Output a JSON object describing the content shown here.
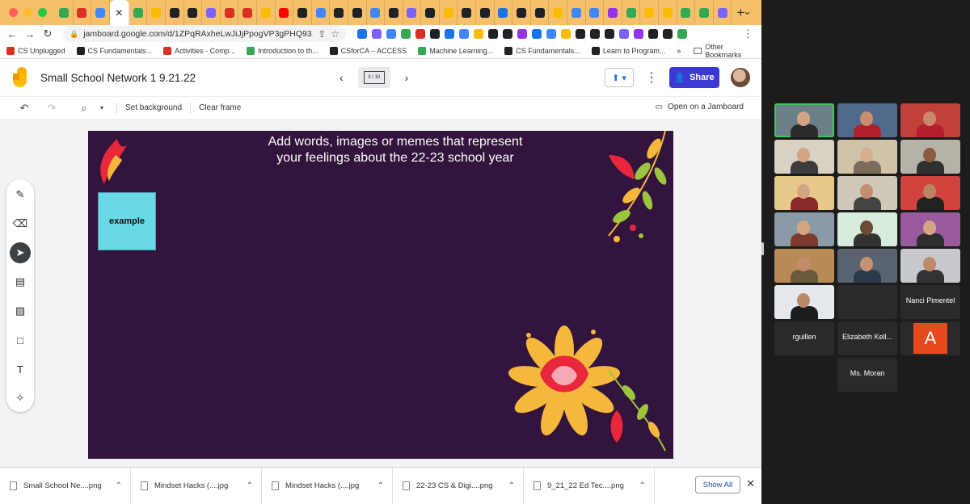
{
  "browser": {
    "active_tab_close": "✕",
    "new_tab": "+",
    "url": "jamboard.google.com/d/1ZPqRAxheLwJiJjPpogVP3gPHQ93...",
    "tab_favicon_colors": [
      "#34a853",
      "#d93025",
      "#4285f4",
      "#34a853",
      "#fbbc04",
      "#202124",
      "#202124",
      "#7b61ff",
      "#d93025",
      "#d93025",
      "#fbbc04",
      "#ff0000",
      "#202124",
      "#4285f4",
      "#202124",
      "#202124",
      "#4285f4",
      "#202124",
      "#7b61ff",
      "#202124",
      "#fbbc04",
      "#202124",
      "#202124",
      "#1a73e8",
      "#202124",
      "#202124",
      "#fbbc04",
      "#4285f4",
      "#4285f4",
      "#9334e6",
      "#34a853",
      "#fbbc04",
      "#fbbc04",
      "#34a853",
      "#34a853",
      "#7b61ff"
    ],
    "ext_icon_colors": [
      "#1a73e8",
      "#7b61ff",
      "#4285f4",
      "#34a853",
      "#d93025",
      "#202124",
      "#1a73e8",
      "#4285f4",
      "#fbbc04",
      "#202124",
      "#202124",
      "#9334e6",
      "#1a73e8",
      "#4285f4",
      "#fbbc04",
      "#202124",
      "#202124",
      "#202124",
      "#7b61ff",
      "#9334e6",
      "#202124",
      "#202124",
      "#34a853"
    ]
  },
  "bookmarks": [
    {
      "label": "CS Unplugged",
      "color": "#d93025"
    },
    {
      "label": "CS Fundamentals...",
      "color": "#202124"
    },
    {
      "label": "Activities - Comp...",
      "color": "#d93025"
    },
    {
      "label": "Introduction to th...",
      "color": "#34a853"
    },
    {
      "label": "CSforCA – ACCESS",
      "color": "#202124"
    },
    {
      "label": "Machine Learning...",
      "color": "#34a853"
    },
    {
      "label": "CS Fundamentals...",
      "color": "#202124"
    },
    {
      "label": "Learn to Program...",
      "color": "#202124"
    }
  ],
  "bookmarks_more": "»",
  "other_bookmarks": "Other Bookmarks",
  "app": {
    "title": "Small School Network 1 9.21.22",
    "frame_counter": "3 / 10",
    "share_label": "Share",
    "set_background": "Set background",
    "clear_frame": "Clear frame",
    "open_on_jamboard": "Open on a Jamboard"
  },
  "frame": {
    "prompt": "Add words, images or memes that represent your feelings about the 22-23 school year",
    "sticky_note": "example",
    "background_color": "#33143d",
    "sticky_color": "#6ad9e6"
  },
  "downloads": [
    "Small School Ne....png",
    "Mindset Hacks (....jpg",
    "Mindset Hacks (....jpg",
    "22-23 CS & Digi....png",
    "9_21_22 Ed Tec....png"
  ],
  "show_all": "Show All",
  "meeting": {
    "participants": [
      {
        "kind": "video",
        "bg": "#6b7f87",
        "skin": "#d4a585",
        "shirt": "#2b2b2b",
        "speaking": true
      },
      {
        "kind": "video",
        "bg": "#4f6a8a",
        "skin": "#c98f6d",
        "shirt": "#b01f2a"
      },
      {
        "kind": "video",
        "bg": "#c2403c",
        "skin": "#c88a6a",
        "shirt": "#b51e2e"
      },
      {
        "kind": "video",
        "bg": "#d9d2c4",
        "skin": "#d4a585",
        "shirt": "#3c3c3c"
      },
      {
        "kind": "video",
        "bg": "#cfc3a8",
        "skin": "#d7ae8e",
        "shirt": "#7a6c5a"
      },
      {
        "kind": "video",
        "bg": "#b7b2a8",
        "skin": "#8a5c42",
        "shirt": "#303030"
      },
      {
        "kind": "video",
        "bg": "#e8c98a",
        "skin": "#d4a585",
        "shirt": "#8a2a2a"
      },
      {
        "kind": "video",
        "bg": "#cfc9bb",
        "skin": "#c48f6e",
        "shirt": "#444"
      },
      {
        "kind": "video",
        "bg": "#d0433f",
        "skin": "#b88462",
        "shirt": "#222"
      },
      {
        "kind": "video",
        "bg": "#8a9aa6",
        "skin": "#d4a585",
        "shirt": "#7a3b2c"
      },
      {
        "kind": "video",
        "bg": "#d8ecde",
        "skin": "#6b4a36",
        "shirt": "#333"
      },
      {
        "kind": "video",
        "bg": "#9a5a9e",
        "skin": "#d4a585",
        "shirt": "#2e2e2e"
      },
      {
        "kind": "video",
        "bg": "#b98a55",
        "skin": "#c28c6a",
        "shirt": "#6b5a3a"
      },
      {
        "kind": "video",
        "bg": "#5a6470",
        "skin": "#c69274",
        "shirt": "#2b3a4a"
      },
      {
        "kind": "video",
        "bg": "#c7c9cc",
        "skin": "#c08b6b",
        "shirt": "#333"
      },
      {
        "kind": "video",
        "bg": "#e5e8ec",
        "skin": "#b88a6a",
        "shirt": "#1d1d1d"
      },
      {
        "kind": "empty"
      },
      {
        "kind": "name",
        "label": "Nanci Pimentel"
      },
      {
        "kind": "name",
        "label": "rguillen"
      },
      {
        "kind": "name",
        "label": "Elizabeth Kell..."
      },
      {
        "kind": "avatar",
        "label": "A"
      },
      {
        "kind": "name",
        "label": "Ms. Moran"
      }
    ]
  }
}
